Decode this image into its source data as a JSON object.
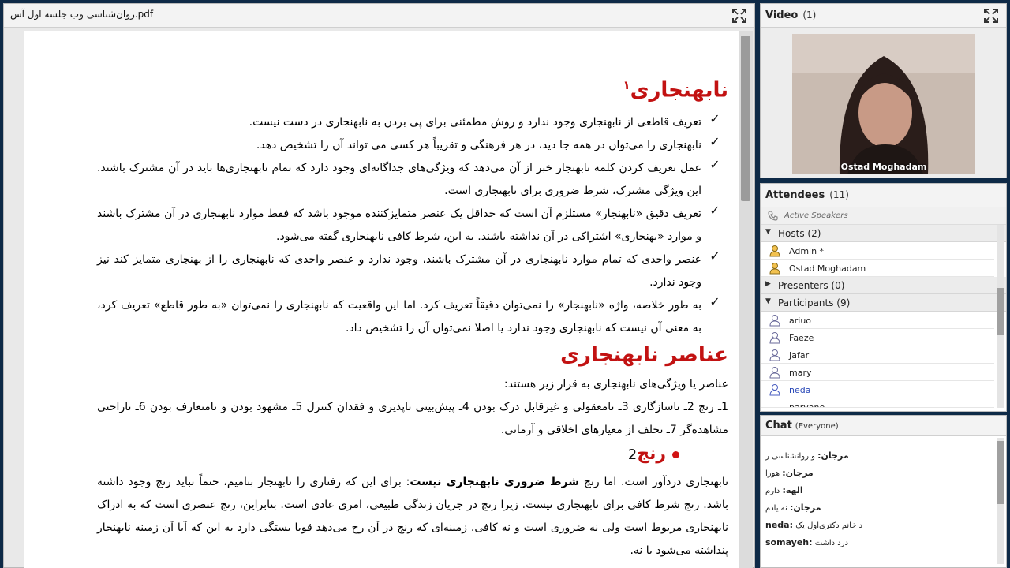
{
  "pdf": {
    "title": "روان‌شناسی وب جلسه اول آس.pdf",
    "heading1": "نابهنجاری",
    "heading1_footnote": "۱",
    "bullets": [
      "تعریف قاطعی از نابهنجاری وجود ندارد و روش مطمئنی برای پی بردن به نابهنجاری در دست نیست.",
      "نابهنجاری را می‌توان در همه جا دید، در هر فرهنگی و تقریباً هر کسی می تواند آن را تشخیص دهد.",
      "عمل تعریف کردن کلمه نابهنجار خبر از آن می‌دهد که ویژگی‌های جداگانه‌ای وجود دارد که تمام نابهنجاری‌ها باید در آن مشترک باشند. این ویژگی مشترک، شرط ضروری برای نابهنجاری است.",
      "تعریف دقیق «نابهنجار» مستلزم آن است که حداقل یک عنصر متمایزکننده موجود باشد که فقط موارد نابهنجاری در آن مشترک باشند و موارد «بهنجاری» اشتراکی در آن نداشته باشند. به این، شرط کافی نابهنجاری گفته می‌شود.",
      "عنصر واحدی که تمام موارد نابهنجاری در آن مشترک باشند، وجود ندارد و عنصر واحدی که نابهنجاری را از بهنجاری متمایز کند نیز وجود ندارد.",
      "به طور خلاصه، واژه «نابهنجار» را نمی‌توان دقیقاً تعریف کرد. اما این واقعیت که نابهنجاری را نمی‌توان «به طور قاطع» تعریف کرد، به معنی آن نیست که نابهنجاری وجود ندارد یا اصلا نمی‌توان آن را تشخیص داد."
    ],
    "heading2": "عناصر نابهنجاری",
    "elements_intro": "عناصر یا ویژگی‌های نابهنجاری به قرار زیر هستند:",
    "elements_list": "1ـ رنج 2ـ ناسازگاری 3ـ نامعقولی و غیرقابل درک بودن 4ـ پیش‌بینی ناپذیری و فقدان کنترل 5ـ مشهود بودن و نامتعارف بودن 6ـ ناراحتی مشاهده‌گر 7ـ تخلف از معیارهای اخلاقی و آرمانی.",
    "heading3": "رنج",
    "heading3_num": "2",
    "pain_para_start": "نابهنجاری دردآور است. اما رنج ",
    "pain_para_bold": "شرط ضروری نابهنجاری نیست",
    "pain_para_rest": ": برای این که رفتاری را نابهنجار بنامیم، حتماً نباید رنج وجود داشته باشد. رنج شرط کافی برای نابهنجاری نیست. زیرا رنج در جریان زندگی طبیعی، امری عادی است. بنابراین، رنج عنصری است که به ادراک نابهنجاری مربوط است ولی نه ضروری است و نه کافی. زمینه‌ای که رنج در آن رخ می‌دهد قویا بستگی دارد به این که آیا آن زمینه نابهنجار پنداشته می‌شود یا نه."
  },
  "video": {
    "title": "Video",
    "count": "(1)",
    "speaker": "Ostad Moghadam"
  },
  "attendees": {
    "title": "Attendees",
    "count": "(11)",
    "active_speakers": "Active Speakers",
    "hosts_label": "Hosts (2)",
    "hosts": [
      "Admin *",
      "Ostad Moghadam"
    ],
    "presenters_label": "Presenters (0)",
    "participants_label": "Participants (9)",
    "participants": [
      "ariuo",
      "Faeze",
      "Jafar",
      "mary",
      "neda",
      "parvane"
    ]
  },
  "chat": {
    "title": "Chat",
    "scope": "(Everyone)",
    "messages": [
      {
        "sender": "مرجان:",
        "text": "و روانشناسی ر"
      },
      {
        "sender": "مرجان:",
        "text": "هورا"
      },
      {
        "sender": "الهه:",
        "text": "دارم"
      },
      {
        "sender": "مرجان:",
        "text": "نه یادم"
      },
      {
        "sender": "neda:",
        "text": "د خانم دکتری‌اول یک"
      },
      {
        "sender": "somayeh:",
        "text": "درد داشت"
      }
    ]
  },
  "colors": {
    "background": "#0e2a47",
    "heading_red": "#c21212",
    "pane": "#e9e9e9"
  }
}
